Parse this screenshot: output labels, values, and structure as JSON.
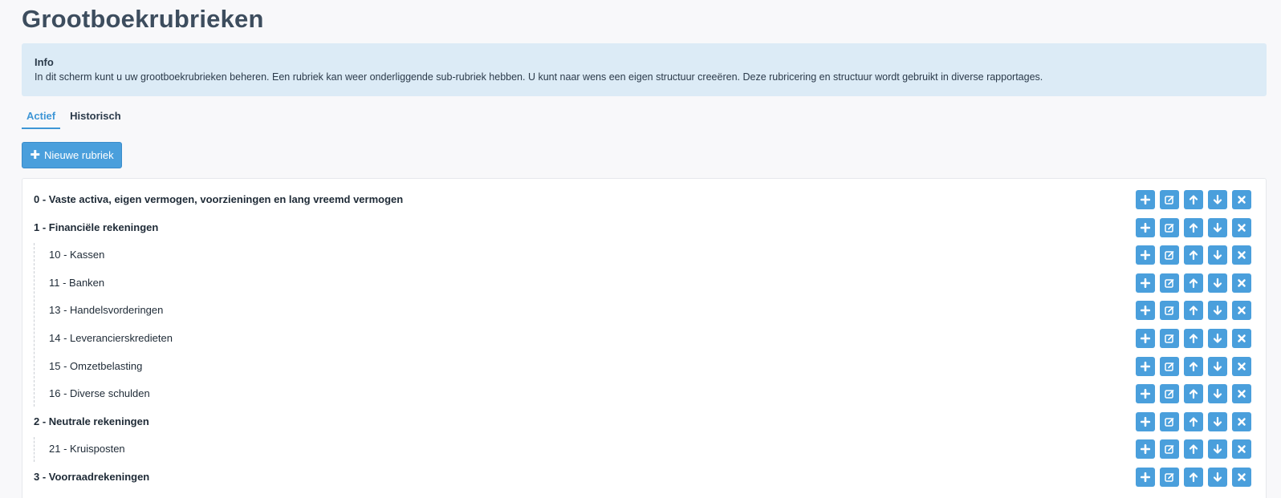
{
  "page": {
    "title": "Grootboekrubrieken"
  },
  "info": {
    "title": "Info",
    "text": "In dit scherm kunt u uw grootboekrubrieken beheren. Een rubriek kan weer onderliggende sub-rubriek hebben. U kunt naar wens een eigen structuur creeëren. Deze rubricering en structuur wordt gebruikt in diverse rapportages."
  },
  "tabs": [
    {
      "label": "Actief",
      "active": true
    },
    {
      "label": "Historisch",
      "active": false
    }
  ],
  "new_button": {
    "label": "Nieuwe rubriek",
    "icon": "plus-icon"
  },
  "rows": [
    {
      "label": "0 - Vaste activa, eigen vermogen, voorzieningen en lang vreemd vermogen",
      "level": 0
    },
    {
      "label": "1 - Financiële rekeningen",
      "level": 0
    },
    {
      "label": "10 - Kassen",
      "level": 1
    },
    {
      "label": "11 - Banken",
      "level": 1
    },
    {
      "label": "13 - Handelsvorderingen",
      "level": 1
    },
    {
      "label": "14 - Leverancierskredieten",
      "level": 1
    },
    {
      "label": "15 - Omzetbelasting",
      "level": 1
    },
    {
      "label": "16 - Diverse schulden",
      "level": 1
    },
    {
      "label": "2 - Neutrale rekeningen",
      "level": 0
    },
    {
      "label": "21 - Kruisposten",
      "level": 1
    },
    {
      "label": "3 - Voorraadrekeningen",
      "level": 0
    }
  ],
  "row_actions": [
    {
      "name": "add-subrubriek-button",
      "icon": "plus-icon"
    },
    {
      "name": "edit-button",
      "icon": "edit-icon"
    },
    {
      "name": "move-up-button",
      "icon": "arrow-up-icon"
    },
    {
      "name": "move-down-button",
      "icon": "arrow-down-icon"
    },
    {
      "name": "delete-button",
      "icon": "close-icon"
    }
  ],
  "colors": {
    "accent": "#4a9fdc",
    "info_background": "#dcebf6",
    "title": "#3d4d5e"
  }
}
